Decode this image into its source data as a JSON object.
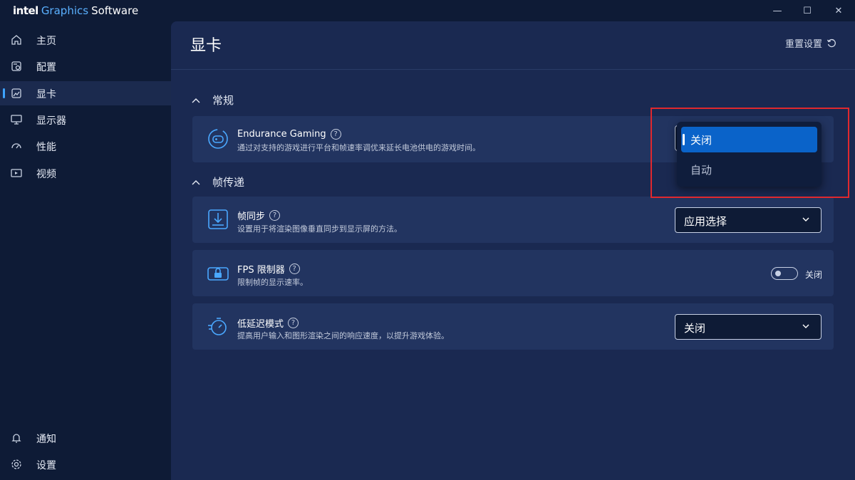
{
  "app": {
    "brand_intel": "intel",
    "brand_graphics": "Graphics",
    "brand_software": "Software"
  },
  "window_controls": {
    "minimize": "—",
    "maximize": "☐",
    "close": "✕"
  },
  "sidebar": {
    "items": [
      {
        "label": "主页"
      },
      {
        "label": "配置"
      },
      {
        "label": "显卡"
      },
      {
        "label": "显示器"
      },
      {
        "label": "性能"
      },
      {
        "label": "视频"
      }
    ],
    "bottom": [
      {
        "label": "通知"
      },
      {
        "label": "设置"
      }
    ]
  },
  "header": {
    "title": "显卡",
    "reset_label": "重置设置"
  },
  "sections": [
    {
      "label": "常规"
    },
    {
      "label": "帧传递"
    }
  ],
  "cards": {
    "endurance": {
      "title": "Endurance Gaming",
      "desc": "通过对支持的游戏进行平台和帧速率调优来延长电池供电的游戏时间。"
    },
    "vsync": {
      "title": "帧同步",
      "desc": "设置用于将渲染图像垂直同步到显示屏的方法。",
      "value": "应用选择"
    },
    "fps": {
      "title": "FPS 限制器",
      "desc": "限制帧的显示速率。",
      "toggle_label": "关闭"
    },
    "latency": {
      "title": "低延迟模式",
      "desc": "提高用户输入和图形渲染之间的响应速度，以提升游戏体验。",
      "value": "关闭"
    }
  },
  "help_glyph": "?",
  "dropdown": {
    "options": [
      {
        "label": "关闭"
      },
      {
        "label": "自动"
      }
    ],
    "selected_index": 0
  },
  "colors": {
    "accent": "#0a63c9",
    "highlight": "#e0282e",
    "background": "#0e1b36",
    "panel": "#1a2951",
    "card": "#223460"
  }
}
